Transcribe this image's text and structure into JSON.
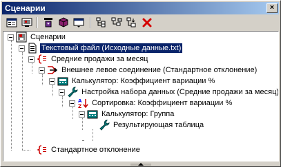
{
  "window": {
    "title": "Сценарии",
    "close_glyph": "×"
  },
  "toolbar": {
    "buttons": [
      {
        "icon": "properties-icon"
      },
      {
        "icon": "monitor-icon"
      },
      {
        "icon": "move-down-icon"
      },
      {
        "icon": "cube-icon"
      },
      {
        "icon": "window-icon"
      },
      {
        "icon": "tree-expand-icon"
      },
      {
        "icon": "tree-collapse-icon"
      },
      {
        "icon": "tree-add-icon"
      },
      {
        "icon": "delete-icon"
      }
    ]
  },
  "tree": {
    "nodes": [
      {
        "label": "Сценарии",
        "icon": "scenarios-icon"
      },
      {
        "label": "Текстовый файл (Исходные данные.txt)",
        "icon": "text-file-icon",
        "selected": true
      },
      {
        "label": "Средние продажи за месяц",
        "icon": "bracket-icon"
      },
      {
        "label": "Внешнее левое соединение (Стандартное отклонение)",
        "icon": "join-icon"
      },
      {
        "label": "Калькулятор: Коэффициент вариации %",
        "icon": "calculator-icon"
      },
      {
        "label": "Настройка набора данных (Средние продажи за месяц)",
        "icon": "wrench-icon"
      },
      {
        "label": "Сортировка: Коэффициент вариации %",
        "icon": "sort-icon"
      },
      {
        "label": "Калькулятор: Группа",
        "icon": "calculator-icon"
      },
      {
        "label": "Результирующая таблица",
        "icon": "wrench-icon"
      },
      {
        "label": "Стандартное отклонение",
        "icon": "bracket-icon"
      }
    ]
  }
}
